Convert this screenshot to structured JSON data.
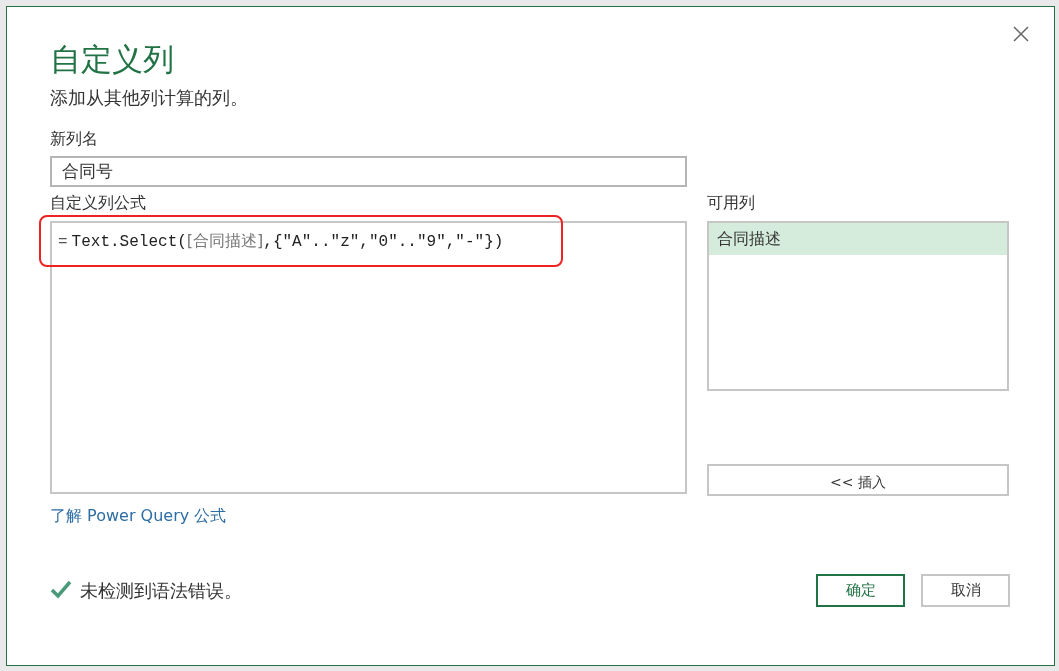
{
  "dialog": {
    "title": "自定义列",
    "subtitle": "添加从其他列计算的列。",
    "new_column_label": "新列名",
    "new_column_value": "合同号",
    "formula_label": "自定义列公式",
    "formula": [
      {
        "kind": "operator",
        "text": "="
      },
      {
        "kind": "code",
        "text": "Text.Select("
      },
      {
        "kind": "column",
        "text": "[合同描述]"
      },
      {
        "kind": "code",
        "text": ",{\"A\"..\"z\",\"0\"..\"9\",\"-\"})"
      }
    ],
    "formula_highlighted": true,
    "available_columns_label": "可用列",
    "available_columns": [
      {
        "label": "合同描述",
        "selected": true
      }
    ],
    "insert_button": "<< 插入",
    "help_link": "了解 Power Query 公式",
    "status": {
      "ok": true,
      "text": "未检测到语法错误。"
    },
    "buttons": [
      {
        "label": "确定",
        "primary": true
      },
      {
        "label": "取消",
        "primary": false
      }
    ]
  }
}
